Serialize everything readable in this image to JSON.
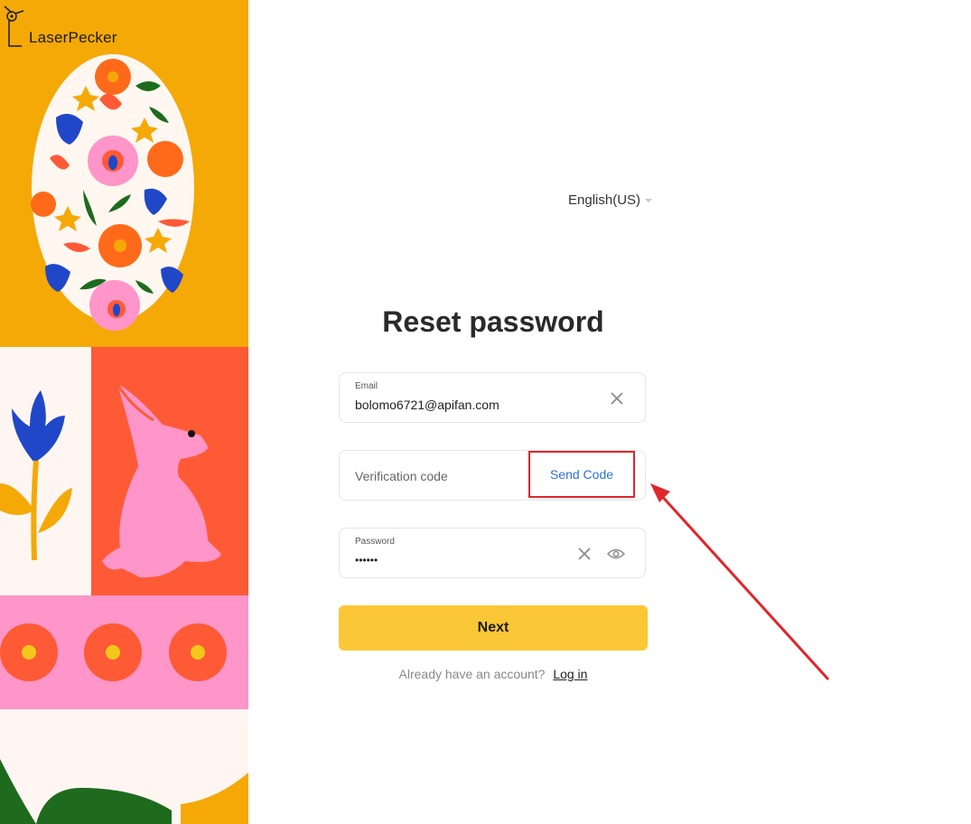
{
  "brand": {
    "name": "LaserPecker"
  },
  "language": {
    "label": "English(US)"
  },
  "form": {
    "title": "Reset password",
    "email": {
      "label": "Email",
      "value": "bolomo6721@apifan.com"
    },
    "verification": {
      "placeholder": "Verification code",
      "send_label": "Send Code"
    },
    "password": {
      "label": "Password",
      "value": "••••••"
    },
    "next_label": "Next",
    "login_prompt": "Already have an account?",
    "login_link": "Log in"
  },
  "icons": {
    "email_clear": "close-icon",
    "password_clear": "close-icon",
    "password_toggle": "eye-icon",
    "language_caret": "caret-down-icon"
  },
  "colors": {
    "accent_yellow": "#fac736",
    "link_blue": "#2f6fd8",
    "highlight_red": "#e0262b",
    "panel_orange": "#f4a907",
    "panel_coral": "#ff5a36",
    "panel_pink": "#ff95c8"
  }
}
